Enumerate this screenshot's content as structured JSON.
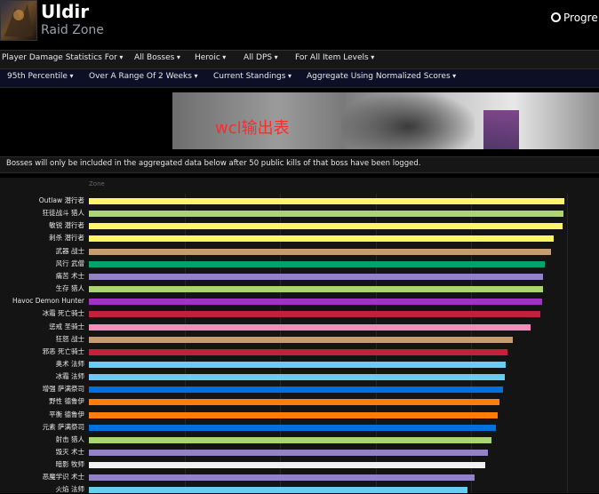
{
  "header": {
    "title": "Uldir",
    "subtitle": "Raid Zone",
    "progress_label": "Progre"
  },
  "filters_row1": [
    "Player Damage Statistics For",
    "All Bosses",
    "Heroic",
    "All DPS",
    "For All Item Levels"
  ],
  "filters_row2": [
    "95th Percentile",
    "Over A Range Of 2 Weeks",
    "Current Standings",
    "Aggregate Using Normalized Scores"
  ],
  "banner": {
    "text": "wcl输出表"
  },
  "notice": "Bosses will only be included in the aggregated data below after 50 public kills of that boss have been logged.",
  "chart_data": {
    "type": "bar",
    "orientation": "horizontal",
    "xlabel": "Zone",
    "grid": true,
    "xlim": [
      0,
      100
    ],
    "categories": [
      "Outlaw 潜行者",
      "狂徒战斗 猎人",
      "敏锐 潜行者",
      "刺杀 潜行者",
      "武器 战士",
      "风行 武僧",
      "痛苦 术士",
      "生存 猎人",
      "Havoc Demon Hunter",
      "冰霜 死亡骑士",
      "惩戒 圣骑士",
      "狂怒 战士",
      "邪恶 死亡骑士",
      "奥术 法师",
      "冰霜 法师",
      "增强 萨满祭司",
      "野性 德鲁伊",
      "平衡 德鲁伊",
      "元素 萨满祭司",
      "射击 猎人",
      "毁灭 术士",
      "暗影 牧师",
      "恶魔学识 术士",
      "火焰 法师"
    ],
    "values": [
      100,
      99.8,
      99.7,
      97.8,
      97.2,
      95.8,
      95.6,
      95.5,
      95.4,
      94.9,
      92.9,
      89.2,
      88.1,
      87.7,
      87.4,
      87.1,
      86.3,
      86.0,
      85.7,
      84.7,
      84.0,
      83.4,
      81.1,
      79.7
    ],
    "colors": [
      "#fff569",
      "#abd473",
      "#fff569",
      "#fff569",
      "#c79c6e",
      "#00a36c",
      "#9482c9",
      "#abd473",
      "#a330c9",
      "#c41f3b",
      "#f58cba",
      "#c79c6e",
      "#c41f3b",
      "#69ccf0",
      "#69ccf0",
      "#0070de",
      "#ff7d0a",
      "#ff7d0a",
      "#0070de",
      "#abd473",
      "#9482c9",
      "#f0f0f0",
      "#9482c9",
      "#69ccf0"
    ]
  }
}
